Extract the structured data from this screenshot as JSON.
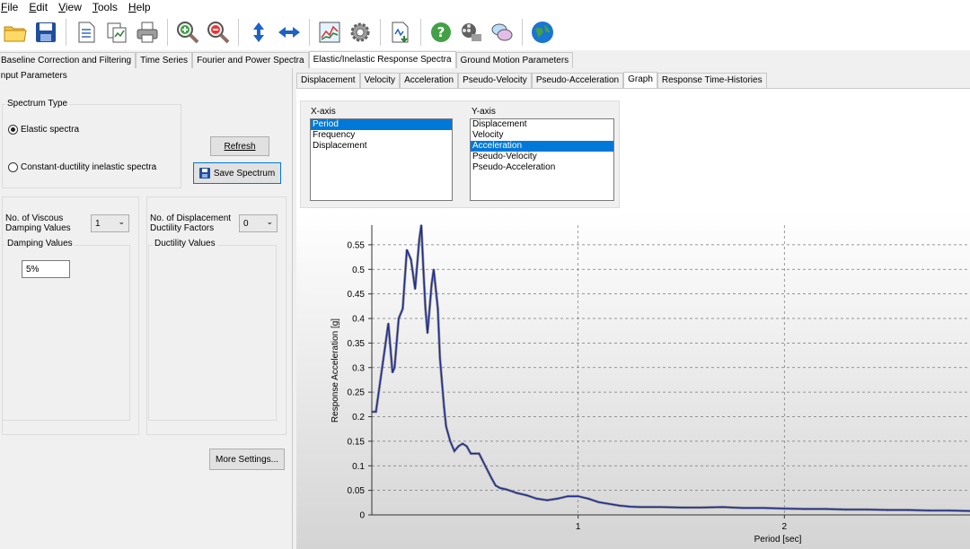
{
  "menu": [
    {
      "label": "File",
      "accel": "F",
      "rest": "ile"
    },
    {
      "label": "Edit",
      "accel": "E",
      "rest": "dit"
    },
    {
      "label": "View",
      "accel": "V",
      "rest": "iew"
    },
    {
      "label": "Tools",
      "accel": "T",
      "rest": "ools"
    },
    {
      "label": "Help",
      "accel": "H",
      "rest": "elp"
    }
  ],
  "toolbar": {
    "icons": [
      "open-folder-icon",
      "save-icon",
      "document-icon",
      "copy-chart-icon",
      "print-icon",
      "zoom-in-icon",
      "zoom-out-icon",
      "vertical-arrows-icon",
      "horizontal-arrows-icon",
      "chart-icon",
      "settings-gear-icon",
      "export-data-icon",
      "help-icon",
      "film-icon",
      "chat-icon",
      "globe-icon"
    ]
  },
  "main_tabs": [
    "Baseline Correction and Filtering",
    "Time Series",
    "Fourier and Power Spectra",
    "Elastic/Inelastic Response Spectra",
    "Ground Motion Parameters"
  ],
  "main_tab_active": 3,
  "left": {
    "input_params_label": "Input Parameters",
    "spectrum_type_label": "Spectrum Type",
    "radio_elastic": "Elastic spectra",
    "radio_inelastic": "Constant-ductility inelastic spectra",
    "refresh_button": "Refresh",
    "save_spectrum_button": "Save Spectrum",
    "viscous_label_1": "No. of Viscous",
    "viscous_label_2": "Damping Values",
    "viscous_value": "1",
    "damping_values_label": "Damping Values",
    "damping_input": "5%",
    "ductility_label_1": "No. of Displacement",
    "ductility_label_2": "Ductility Factors",
    "ductility_value": "0",
    "ductility_values_label": "Ductility Values",
    "more_settings_button": "More Settings..."
  },
  "sub_tabs": [
    "Displacement",
    "Velocity",
    "Acceleration",
    "Pseudo-Velocity",
    "Pseudo-Acceleration",
    "Graph",
    "Response Time-Histories"
  ],
  "sub_tab_active": 5,
  "graph_options": {
    "x_axis_label": "X-axis",
    "x_axis_items": [
      "Period",
      "Frequency",
      "Displacement"
    ],
    "x_axis_selected": 0,
    "y_axis_label": "Y-axis",
    "y_axis_items": [
      "Displacement",
      "Velocity",
      "Acceleration",
      "Pseudo-Velocity",
      "Pseudo-Acceleration"
    ],
    "y_axis_selected": 2
  },
  "chart_data": {
    "type": "line",
    "xlabel": "Period [sec]",
    "ylabel": "Response Acceleration [g]",
    "xlim": [
      0,
      2.9
    ],
    "ylim": [
      0,
      0.59
    ],
    "xticks": [
      1,
      2
    ],
    "yticks": [
      0,
      0.05,
      0.1,
      0.15,
      0.2,
      0.25,
      0.3,
      0.35,
      0.4,
      0.45,
      0.5,
      0.55
    ],
    "grid": true,
    "line_color": "#1f2d8f",
    "series": [
      {
        "x": [
          0.0,
          0.02,
          0.05,
          0.08,
          0.1,
          0.11,
          0.13,
          0.15,
          0.17,
          0.19,
          0.21,
          0.23,
          0.24,
          0.25,
          0.26,
          0.27,
          0.29,
          0.3,
          0.32,
          0.33,
          0.35,
          0.36,
          0.38,
          0.4,
          0.42,
          0.44,
          0.46,
          0.48,
          0.5,
          0.52,
          0.55,
          0.58,
          0.6,
          0.62,
          0.65,
          0.68,
          0.7,
          0.75,
          0.8,
          0.85,
          0.9,
          0.95,
          1.0,
          1.05,
          1.1,
          1.2,
          1.25,
          1.3,
          1.35,
          1.4,
          1.5,
          1.6,
          1.7,
          1.8,
          1.9,
          2.0,
          2.1,
          2.2,
          2.3,
          2.4,
          2.5,
          2.6,
          2.7,
          2.8,
          2.9
        ],
        "y": [
          0.21,
          0.21,
          0.3,
          0.39,
          0.29,
          0.3,
          0.4,
          0.42,
          0.54,
          0.52,
          0.46,
          0.56,
          0.59,
          0.5,
          0.42,
          0.37,
          0.47,
          0.5,
          0.42,
          0.32,
          0.22,
          0.18,
          0.15,
          0.13,
          0.14,
          0.145,
          0.14,
          0.125,
          0.125,
          0.125,
          0.1,
          0.075,
          0.06,
          0.055,
          0.052,
          0.048,
          0.045,
          0.04,
          0.033,
          0.03,
          0.033,
          0.038,
          0.038,
          0.033,
          0.026,
          0.019,
          0.017,
          0.016,
          0.016,
          0.016,
          0.015,
          0.015,
          0.016,
          0.014,
          0.014,
          0.013,
          0.012,
          0.012,
          0.011,
          0.011,
          0.01,
          0.01,
          0.009,
          0.009,
          0.008
        ]
      }
    ]
  }
}
